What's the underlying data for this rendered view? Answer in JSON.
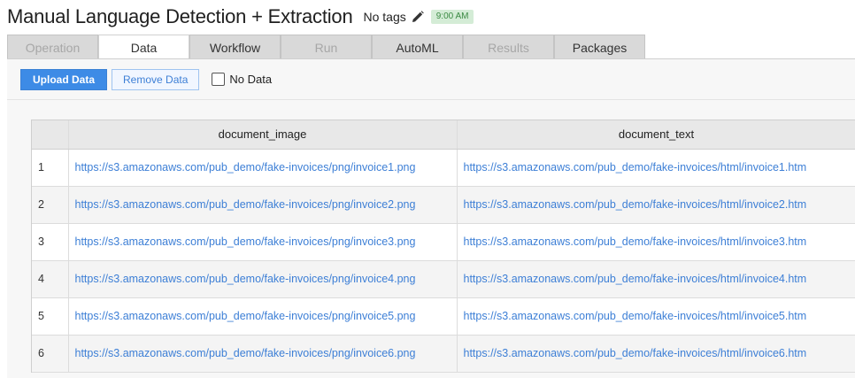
{
  "header": {
    "title": "Manual Language Detection + Extraction",
    "tags_label": "No tags",
    "time_badge": "9:00 AM",
    "badge_color": "#d4ecd6"
  },
  "tabs": [
    {
      "label": "Operation",
      "state": "disabled"
    },
    {
      "label": "Data",
      "state": "active"
    },
    {
      "label": "Workflow",
      "state": "enabled"
    },
    {
      "label": "Run",
      "state": "disabled"
    },
    {
      "label": "AutoML",
      "state": "enabled"
    },
    {
      "label": "Results",
      "state": "disabled"
    },
    {
      "label": "Packages",
      "state": "enabled"
    }
  ],
  "toolbar": {
    "upload_label": "Upload Data",
    "remove_label": "Remove Data",
    "no_data_label": "No Data",
    "no_data_checked": false,
    "accent_color": "#3d8be6"
  },
  "table": {
    "columns": [
      "",
      "document_image",
      "document_text"
    ],
    "rows": [
      {
        "index": "1",
        "document_image": "https://s3.amazonaws.com/pub_demo/fake-invoices/png/invoice1.png",
        "document_text": "https://s3.amazonaws.com/pub_demo/fake-invoices/html/invoice1.htm"
      },
      {
        "index": "2",
        "document_image": "https://s3.amazonaws.com/pub_demo/fake-invoices/png/invoice2.png",
        "document_text": "https://s3.amazonaws.com/pub_demo/fake-invoices/html/invoice2.htm"
      },
      {
        "index": "3",
        "document_image": "https://s3.amazonaws.com/pub_demo/fake-invoices/png/invoice3.png",
        "document_text": "https://s3.amazonaws.com/pub_demo/fake-invoices/html/invoice3.htm"
      },
      {
        "index": "4",
        "document_image": "https://s3.amazonaws.com/pub_demo/fake-invoices/png/invoice4.png",
        "document_text": "https://s3.amazonaws.com/pub_demo/fake-invoices/html/invoice4.htm"
      },
      {
        "index": "5",
        "document_image": "https://s3.amazonaws.com/pub_demo/fake-invoices/png/invoice5.png",
        "document_text": "https://s3.amazonaws.com/pub_demo/fake-invoices/html/invoice5.htm"
      },
      {
        "index": "6",
        "document_image": "https://s3.amazonaws.com/pub_demo/fake-invoices/png/invoice6.png",
        "document_text": "https://s3.amazonaws.com/pub_demo/fake-invoices/html/invoice6.htm"
      }
    ],
    "link_color": "#3d7fd6"
  }
}
